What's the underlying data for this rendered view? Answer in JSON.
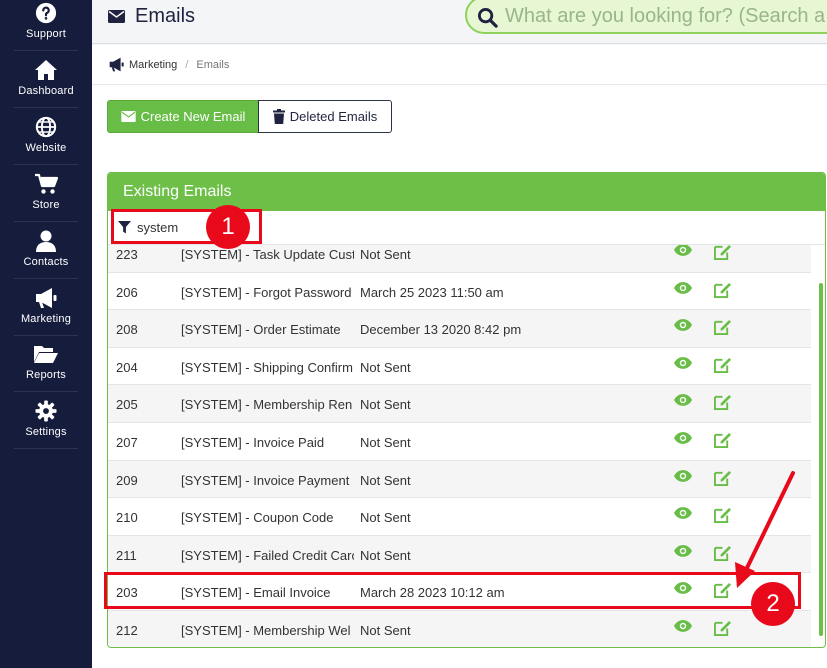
{
  "sidebar": {
    "items": [
      {
        "label": "Support",
        "icon": "question-circle-icon"
      },
      {
        "label": "Dashboard",
        "icon": "home-icon"
      },
      {
        "label": "Website",
        "icon": "globe-icon"
      },
      {
        "label": "Store",
        "icon": "cart-icon"
      },
      {
        "label": "Contacts",
        "icon": "user-icon"
      },
      {
        "label": "Marketing",
        "icon": "megaphone-icon"
      },
      {
        "label": "Reports",
        "icon": "folder-open-icon"
      },
      {
        "label": "Settings",
        "icon": "gear-icon"
      }
    ]
  },
  "header": {
    "title": "Emails",
    "search_placeholder": "What are you looking for? (Search a"
  },
  "breadcrumb": {
    "parent": "Marketing",
    "current": "Emails"
  },
  "toolbar": {
    "create_label": "Create New Email",
    "deleted_label": "Deleted Emails"
  },
  "panel": {
    "title": "Existing Emails",
    "filter_value": "system"
  },
  "emails": [
    {
      "id": "223",
      "name": "[SYSTEM] - Task Update Cust",
      "sent": "Not Sent"
    },
    {
      "id": "206",
      "name": "[SYSTEM] - Forgot Password",
      "sent": "March 25 2023 11:50 am"
    },
    {
      "id": "208",
      "name": "[SYSTEM] - Order Estimate",
      "sent": "December 13 2020 8:42 pm"
    },
    {
      "id": "204",
      "name": "[SYSTEM] - Shipping Confirm",
      "sent": "Not Sent"
    },
    {
      "id": "205",
      "name": "[SYSTEM] - Membership Ren",
      "sent": "Not Sent"
    },
    {
      "id": "207",
      "name": "[SYSTEM] - Invoice Paid",
      "sent": "Not Sent"
    },
    {
      "id": "209",
      "name": "[SYSTEM] - Invoice Payment",
      "sent": "Not Sent"
    },
    {
      "id": "210",
      "name": "[SYSTEM] - Coupon Code",
      "sent": "Not Sent"
    },
    {
      "id": "211",
      "name": "[SYSTEM] - Failed Credit Carc",
      "sent": "Not Sent"
    },
    {
      "id": "203",
      "name": "[SYSTEM] - Email Invoice",
      "sent": "March 28 2023 10:12 am"
    },
    {
      "id": "212",
      "name": "[SYSTEM] - Membership Wel",
      "sent": "Not Sent"
    }
  ],
  "annotations": [
    {
      "number": "1"
    },
    {
      "number": "2"
    }
  ],
  "colors": {
    "sidebar_bg": "#161c3c",
    "accent_green": "#6dbf47",
    "annotation_red": "#e8091a"
  }
}
